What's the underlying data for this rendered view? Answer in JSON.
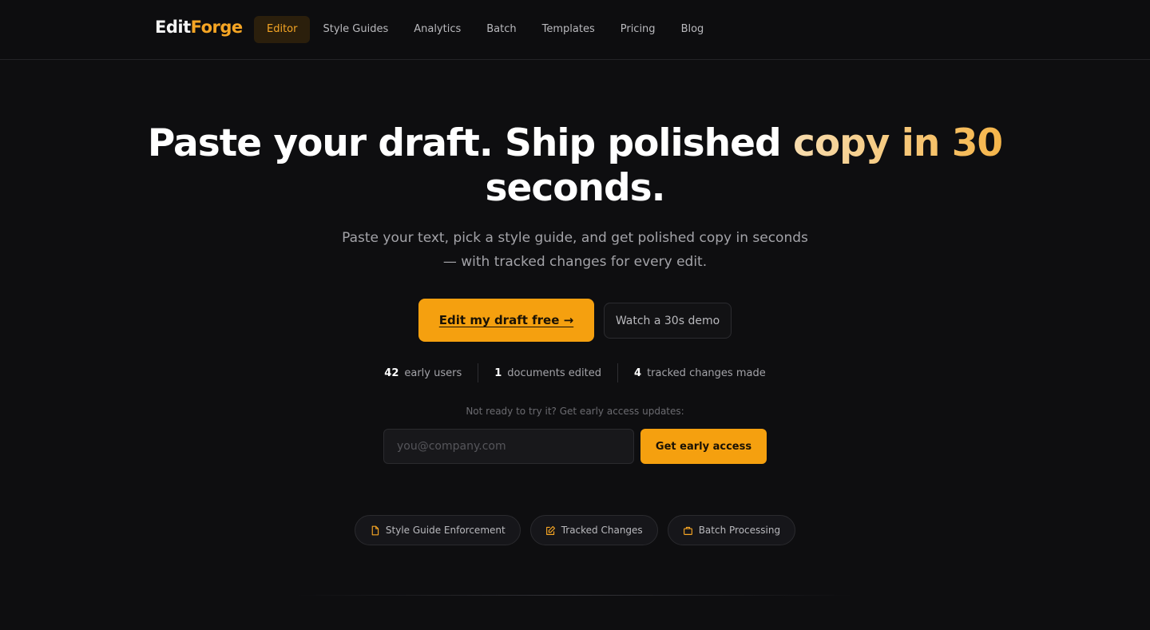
{
  "brand": {
    "part1": "Edit",
    "part2": "Forge"
  },
  "nav": {
    "items": [
      {
        "label": "Editor",
        "active": true
      },
      {
        "label": "Style Guides"
      },
      {
        "label": "Analytics"
      },
      {
        "label": "Batch"
      },
      {
        "label": "Templates"
      },
      {
        "label": "Pricing"
      },
      {
        "label": "Blog"
      }
    ]
  },
  "hero": {
    "title_plain": "Paste your draft. Ship polished ",
    "title_accent": "copy in 30",
    "title_tail": "seconds.",
    "subtitle": "Paste your text, pick a style guide, and get polished copy in seconds — with tracked changes for every edit.",
    "cta_primary": "Edit my draft free →",
    "cta_secondary": "Watch a 30s demo"
  },
  "stats": [
    {
      "value": "42",
      "label": "early users"
    },
    {
      "value": "1",
      "label": "documents edited"
    },
    {
      "value": "4",
      "label": "tracked changes made"
    }
  ],
  "signup": {
    "prompt": "Not ready to try it? Get early access updates:",
    "placeholder": "you@company.com",
    "button": "Get early access"
  },
  "features": [
    {
      "label": "Style Guide Enforcement",
      "icon": "document-icon"
    },
    {
      "label": "Tracked Changes",
      "icon": "edit-icon"
    },
    {
      "label": "Batch Processing",
      "icon": "briefcase-icon"
    }
  ],
  "colors": {
    "accent": "#f5a00f",
    "background": "#0e0e10"
  }
}
